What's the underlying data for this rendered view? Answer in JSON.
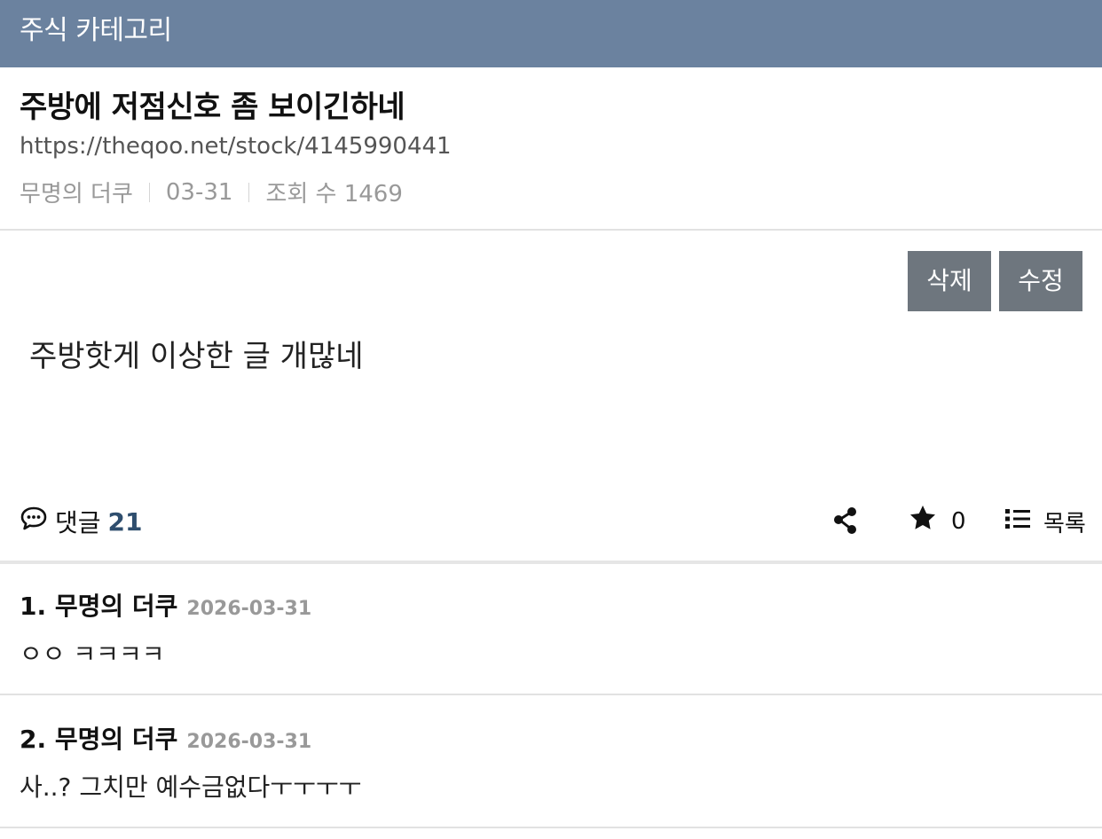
{
  "category": {
    "title": "주식 카테고리"
  },
  "post": {
    "title": "주방에 저점신호 좀 보이긴하네",
    "url": "https://theqoo.net/stock/4145990441",
    "author": "무명의 더쿠",
    "date": "03-31",
    "views": "조회 수 1469",
    "body": "주방핫게 이상한 글 개많네"
  },
  "buttons": {
    "delete": "삭제",
    "edit": "수정"
  },
  "actions": {
    "comment_label": "댓글",
    "comment_count": "21",
    "star_count": "0",
    "list_label": "목록",
    "icons": {
      "comment": "speech-bubble-icon",
      "share": "share-icon",
      "star": "star-icon",
      "list": "list-icon"
    }
  },
  "comments": [
    {
      "author": "1. 무명의 더쿠",
      "date": "2026-03-31",
      "text": "ㅇㅇ ㅋㅋㅋㅋ"
    },
    {
      "author": "2. 무명의 더쿠",
      "date": "2026-03-31",
      "text": "사..? 그치만 예수금없다ㅜㅜㅜㅜ"
    }
  ],
  "colors": {
    "header_bg": "#6b829f",
    "button_bg": "#6e767e",
    "comment_count": "#2f4e6e",
    "muted": "#999999"
  }
}
